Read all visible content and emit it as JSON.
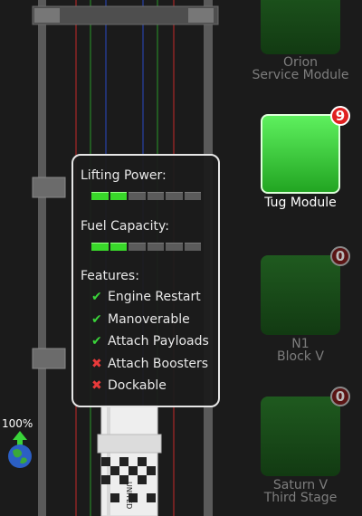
{
  "tooltip": {
    "lifting_label": "Lifting Power:",
    "lifting_level": 0.33,
    "fuel_label": "Fuel Capacity:",
    "fuel_level": 0.33,
    "features_label": "Features:",
    "features": [
      {
        "label": "Engine Restart",
        "enabled": true
      },
      {
        "label": "Manoverable",
        "enabled": true
      },
      {
        "label": "Attach Payloads",
        "enabled": true
      },
      {
        "label": "Attach Boosters",
        "enabled": false
      },
      {
        "label": "Dockable",
        "enabled": false
      }
    ]
  },
  "modules": [
    {
      "line1": "Orion",
      "line2": "Service Module",
      "badge": "",
      "state": "dim"
    },
    {
      "line1": "Tug Module",
      "line2": "",
      "badge": "9",
      "state": "active"
    },
    {
      "line1": "N1",
      "line2": "Block V",
      "badge": "0",
      "state": "dim"
    },
    {
      "line1": "Saturn V",
      "line2": "Third Stage",
      "badge": "0",
      "state": "dim"
    }
  ],
  "earth_indicator": {
    "percent": "100%"
  },
  "rocket": {
    "text": "UNITED"
  },
  "colors": {
    "active_green": "#3ad43a",
    "badge_red": "#e02020",
    "meter_on": "#39d82a"
  }
}
